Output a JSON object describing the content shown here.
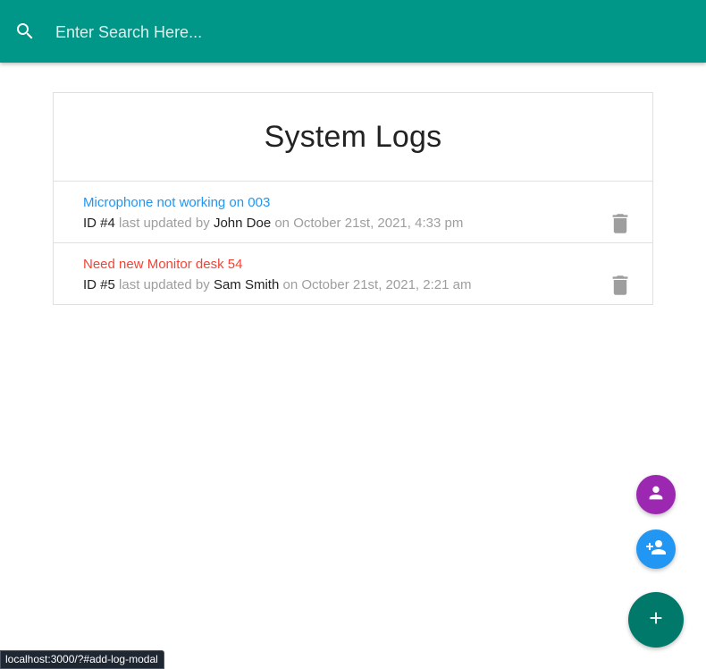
{
  "search": {
    "placeholder": "Enter Search Here...",
    "value": ""
  },
  "logs_panel": {
    "title": "System Logs",
    "items": [
      {
        "message": "Microphone not working on 003",
        "attention": false,
        "id_label": "ID #4",
        "updated_by_text": "last updated by",
        "tech": "John Doe",
        "date_text": "on October 21st, 2021, 4:33 pm"
      },
      {
        "message": "Need new Monitor desk 54",
        "attention": true,
        "id_label": "ID #5",
        "updated_by_text": "last updated by",
        "tech": "Sam Smith",
        "date_text": "on October 21st, 2021, 2:21 am"
      }
    ]
  },
  "status_bar": {
    "url": "localhost:3000/?#add-log-modal"
  },
  "colors": {
    "topbar": "#009688",
    "normal_link": "#2196f3",
    "attention_link": "#f44336",
    "fab_users": "#9c27b0",
    "fab_add_tech": "#2196f3",
    "fab_add_log": "#00796b",
    "icon_grey": "#9e9e9e"
  },
  "icons": {
    "search": "search-icon",
    "delete": "delete-icon",
    "users": "person-icon",
    "add_tech": "person-add-icon",
    "add_log": "add-icon"
  }
}
